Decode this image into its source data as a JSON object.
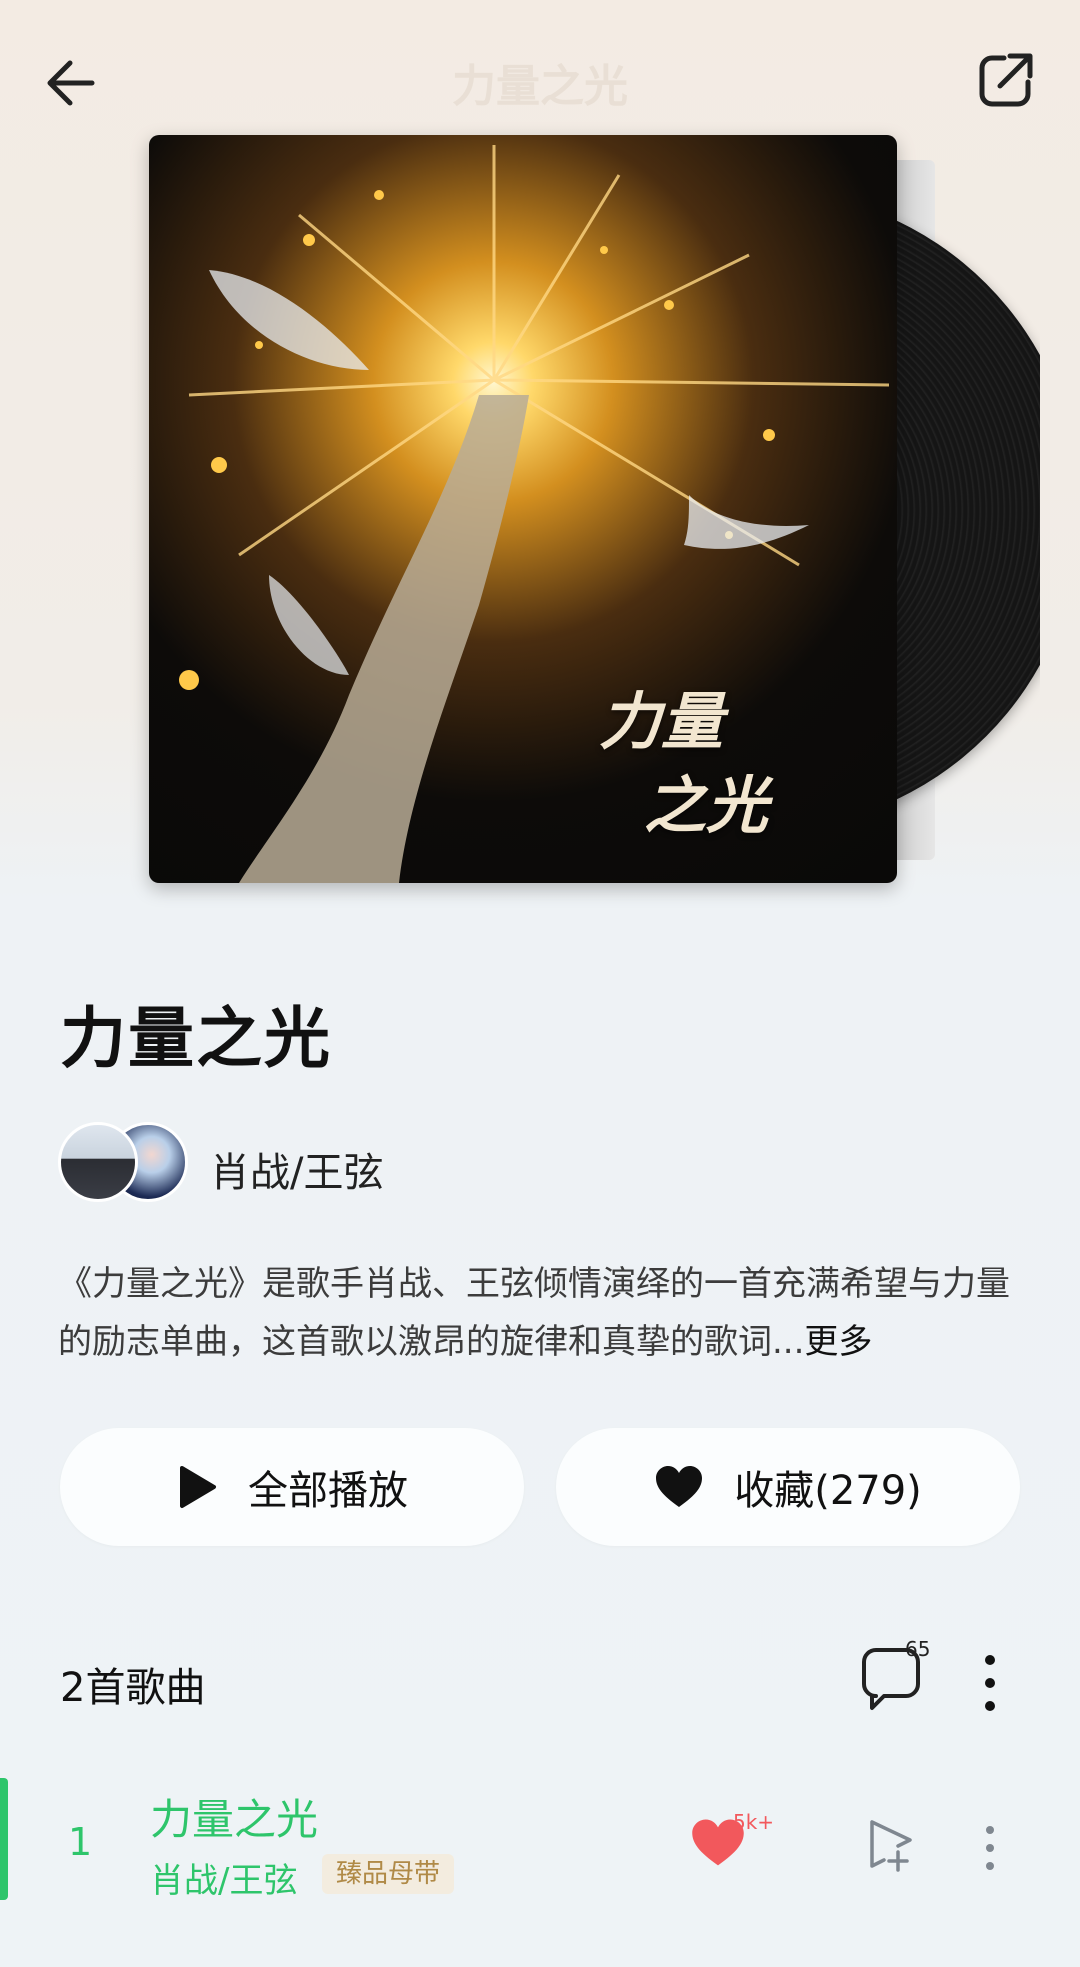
{
  "header": {
    "title": "力量之光"
  },
  "album": {
    "cover_text_line1": "力量",
    "cover_text_line2": "之光",
    "title": "力量之光",
    "artist": "肖战/王弦",
    "description": "《力量之光》是歌手肖战、王弦倾情演绎的一首充满希望与力量的励志单曲，这首歌以激昂的旋律和真挚的歌词...",
    "more_label": "更多"
  },
  "actions": {
    "play_all_label": "全部播放",
    "collect_label": "收藏(279)"
  },
  "song_list": {
    "count_label": "2首歌曲",
    "comment_count": "65",
    "songs": [
      {
        "index": "1",
        "title": "力量之光",
        "artist": "肖战/王弦",
        "badge": "臻品母带",
        "like_count": "5k+"
      }
    ]
  },
  "colors": {
    "accent_green": "#2ec56b",
    "like_red": "#f2585c",
    "badge_gold": "#b08a47"
  },
  "icons": [
    "back-arrow-icon",
    "share-icon",
    "play-icon",
    "heart-icon",
    "comment-icon",
    "more-vertical-icon",
    "add-to-playlist-icon"
  ]
}
